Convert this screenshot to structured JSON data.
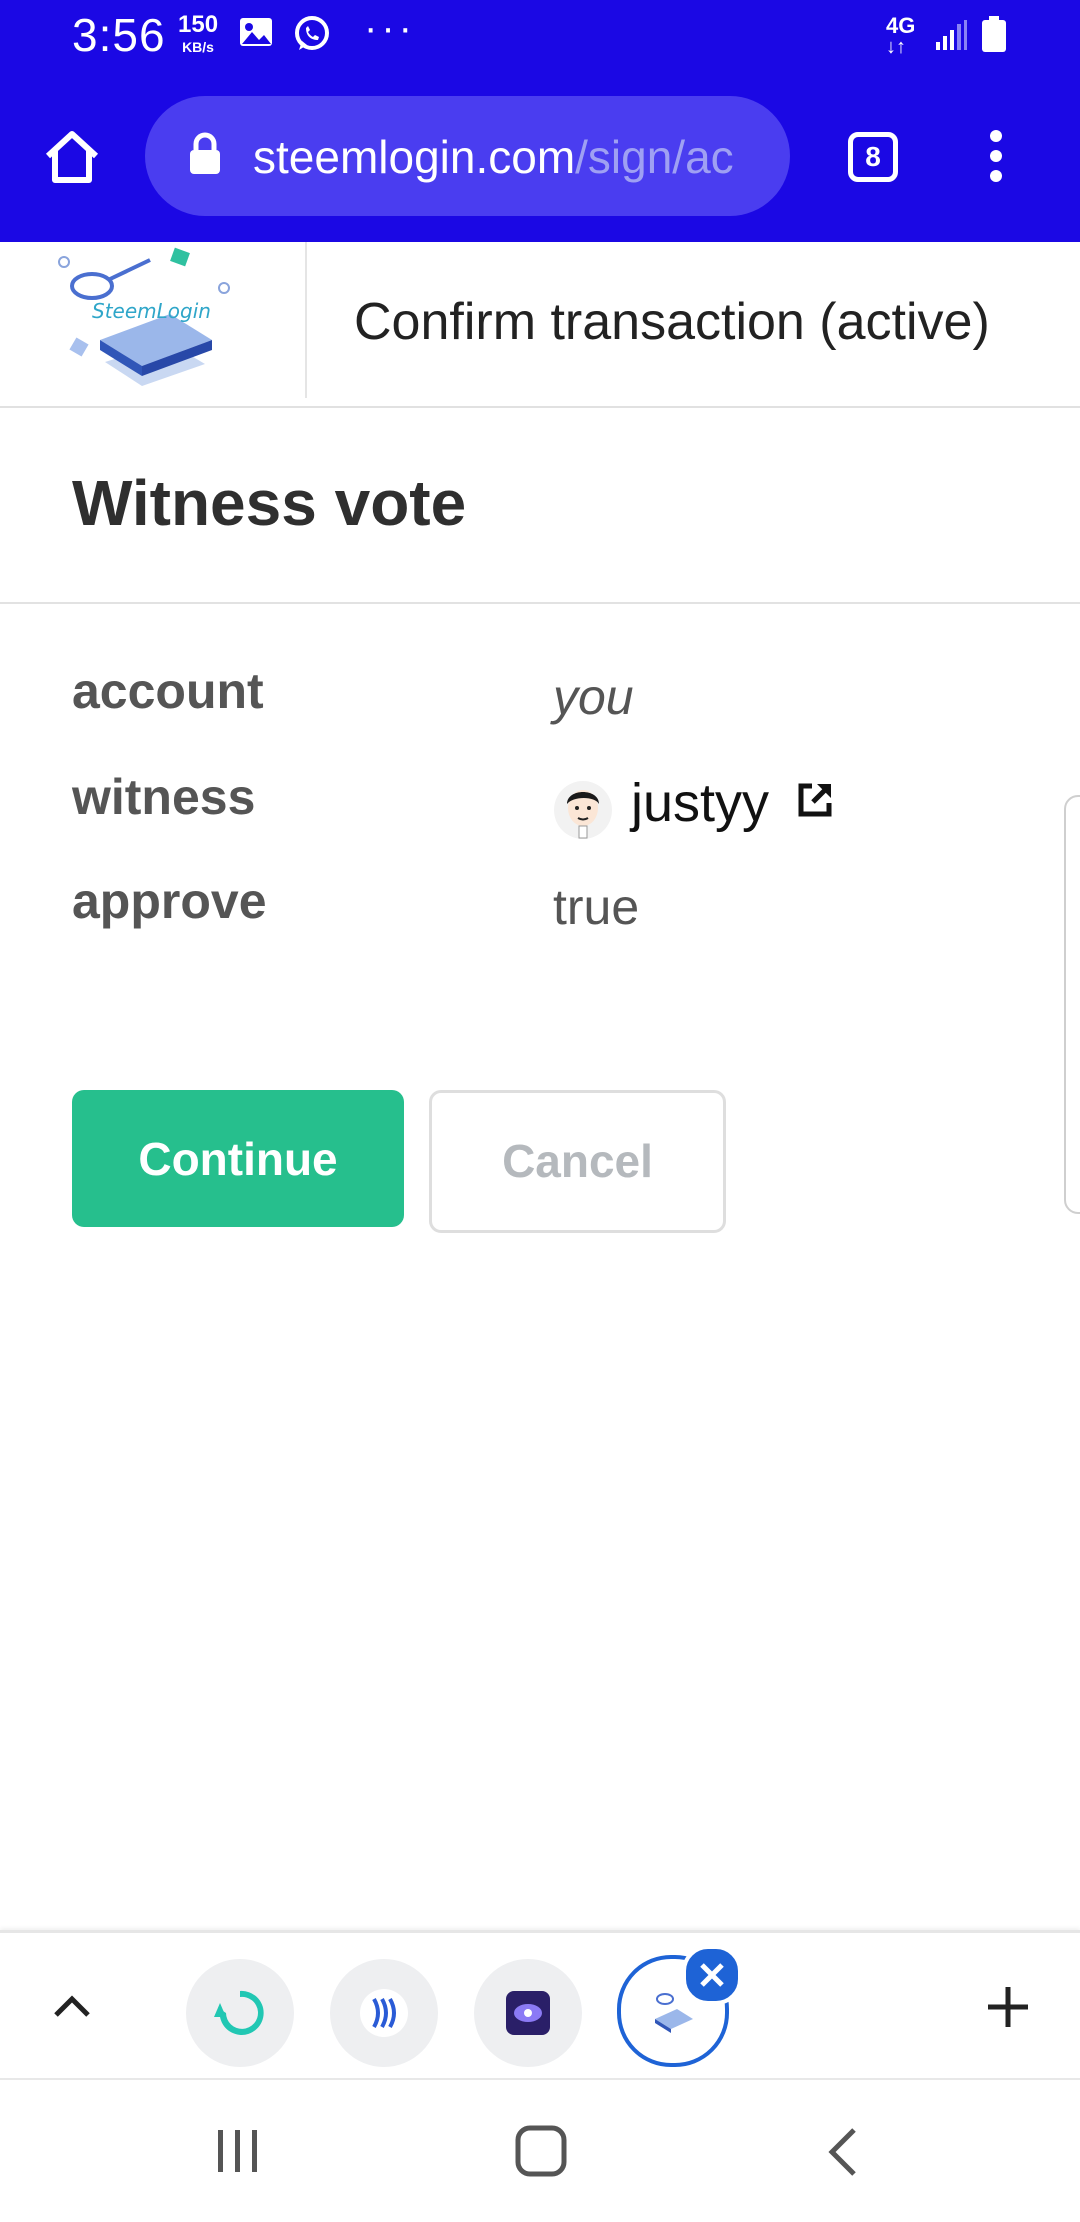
{
  "status_bar": {
    "time": "3:56",
    "speed_value": "150",
    "speed_unit": "KB/s",
    "network": "4G"
  },
  "browser": {
    "url_host": "steemlogin.com",
    "url_path": "/sign/ac",
    "tab_count": "8"
  },
  "header": {
    "logo_text": "SteemLogin",
    "title": "Confirm transaction (active)"
  },
  "operation": {
    "title": "Witness vote",
    "rows": [
      {
        "label": "account",
        "value": "you"
      },
      {
        "label": "witness",
        "value": "justyy"
      },
      {
        "label": "approve",
        "value": "true"
      }
    ]
  },
  "buttons": {
    "continue": "Continue",
    "cancel": "Cancel"
  },
  "colors": {
    "chrome_blue": "#1b08e4",
    "continue_green": "#26bf8d"
  }
}
